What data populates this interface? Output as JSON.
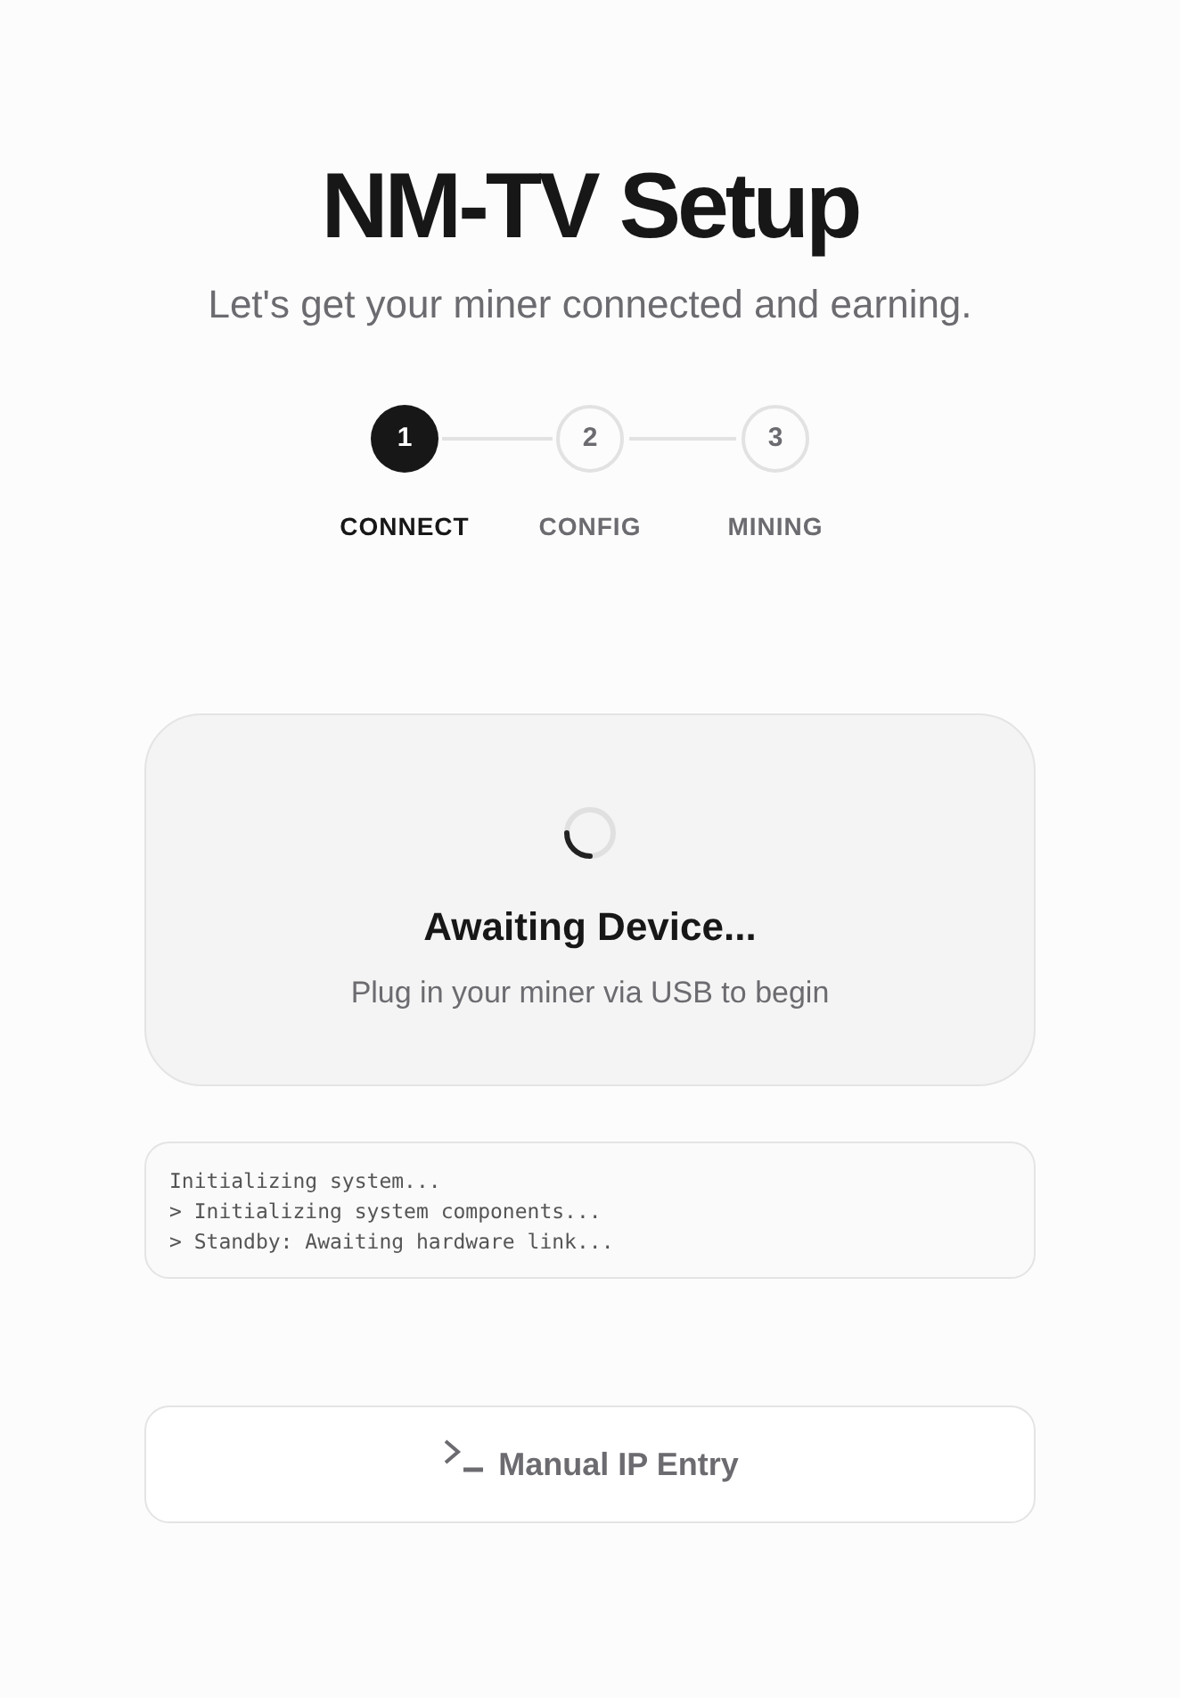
{
  "header": {
    "title": "NM-TV Setup",
    "subtitle": "Let's get your miner connected and earning."
  },
  "steps": [
    {
      "number": "1",
      "label": "CONNECT",
      "selected": true
    },
    {
      "number": "2",
      "label": "CONFIG",
      "selected": false
    },
    {
      "number": "3",
      "label": "MINING",
      "selected": false
    }
  ],
  "status_card": {
    "title": "Awaiting Device...",
    "description": "Plug in your miner via USB to begin"
  },
  "log": [
    "Initializing system...",
    "> Initializing system components...",
    "> Standby: Awaiting hardware link..."
  ],
  "manual_button": {
    "label": "Manual IP Entry"
  }
}
